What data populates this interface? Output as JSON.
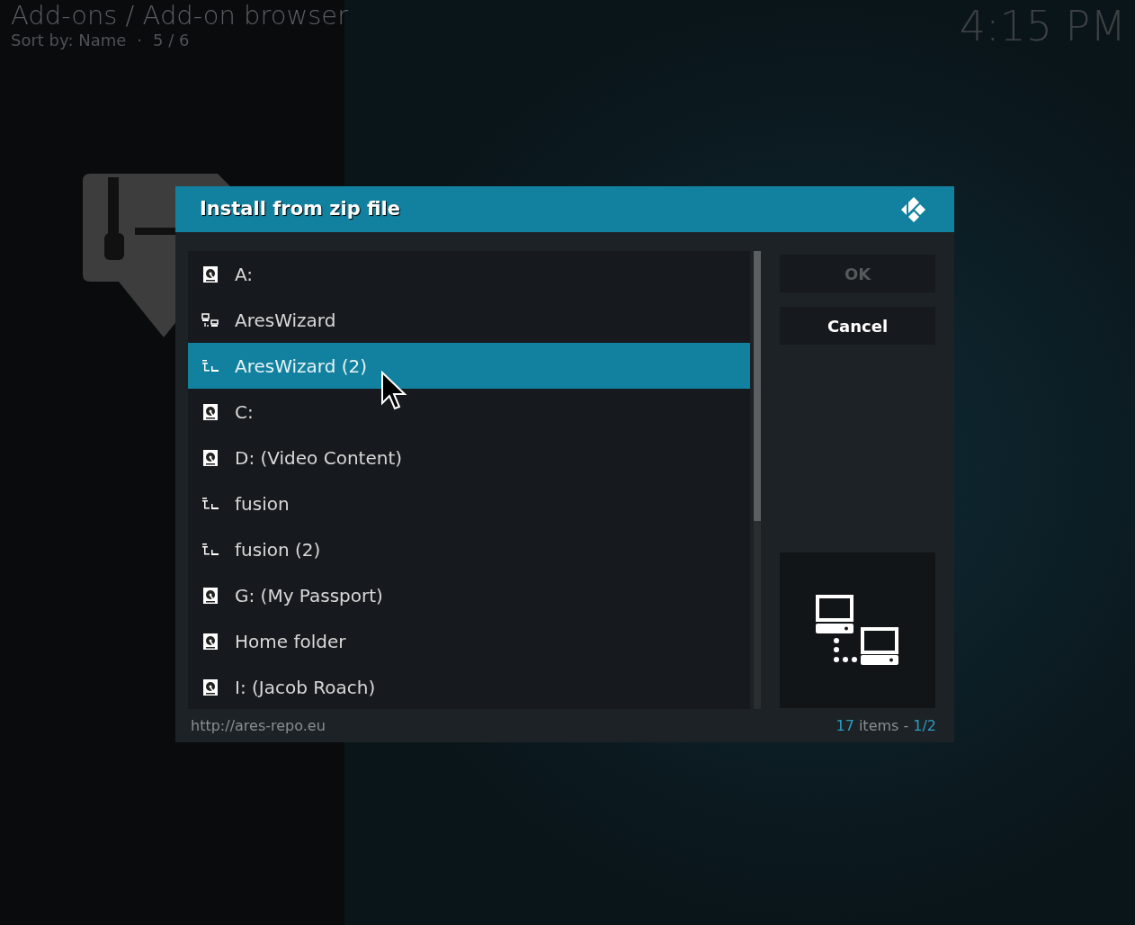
{
  "header": {
    "title": "Add-ons / Add-on browser",
    "sort": "Sort by: Name",
    "separator": "·",
    "position": "5 / 6"
  },
  "clock": "4:15 PM",
  "dialog": {
    "title": "Install from zip file",
    "items": [
      {
        "label": "A:",
        "kind": "drive",
        "selected": false
      },
      {
        "label": "AresWizard",
        "kind": "network",
        "selected": false
      },
      {
        "label": "AresWizard (2)",
        "kind": "share",
        "selected": true
      },
      {
        "label": "C:",
        "kind": "drive",
        "selected": false
      },
      {
        "label": "D: (Video Content)",
        "kind": "drive",
        "selected": false
      },
      {
        "label": "fusion",
        "kind": "share",
        "selected": false
      },
      {
        "label": "fusion (2)",
        "kind": "share",
        "selected": false
      },
      {
        "label": "G: (My Passport)",
        "kind": "drive",
        "selected": false
      },
      {
        "label": "Home folder",
        "kind": "drive",
        "selected": false
      },
      {
        "label": "I: (Jacob Roach)",
        "kind": "drive",
        "selected": false
      }
    ],
    "buttons": [
      {
        "label": "OK",
        "disabled": true
      },
      {
        "label": "Cancel",
        "disabled": false
      }
    ],
    "footer": {
      "path": "http://ares-repo.eu",
      "count": "17",
      "count_label": "items -",
      "page": "1/2"
    }
  }
}
